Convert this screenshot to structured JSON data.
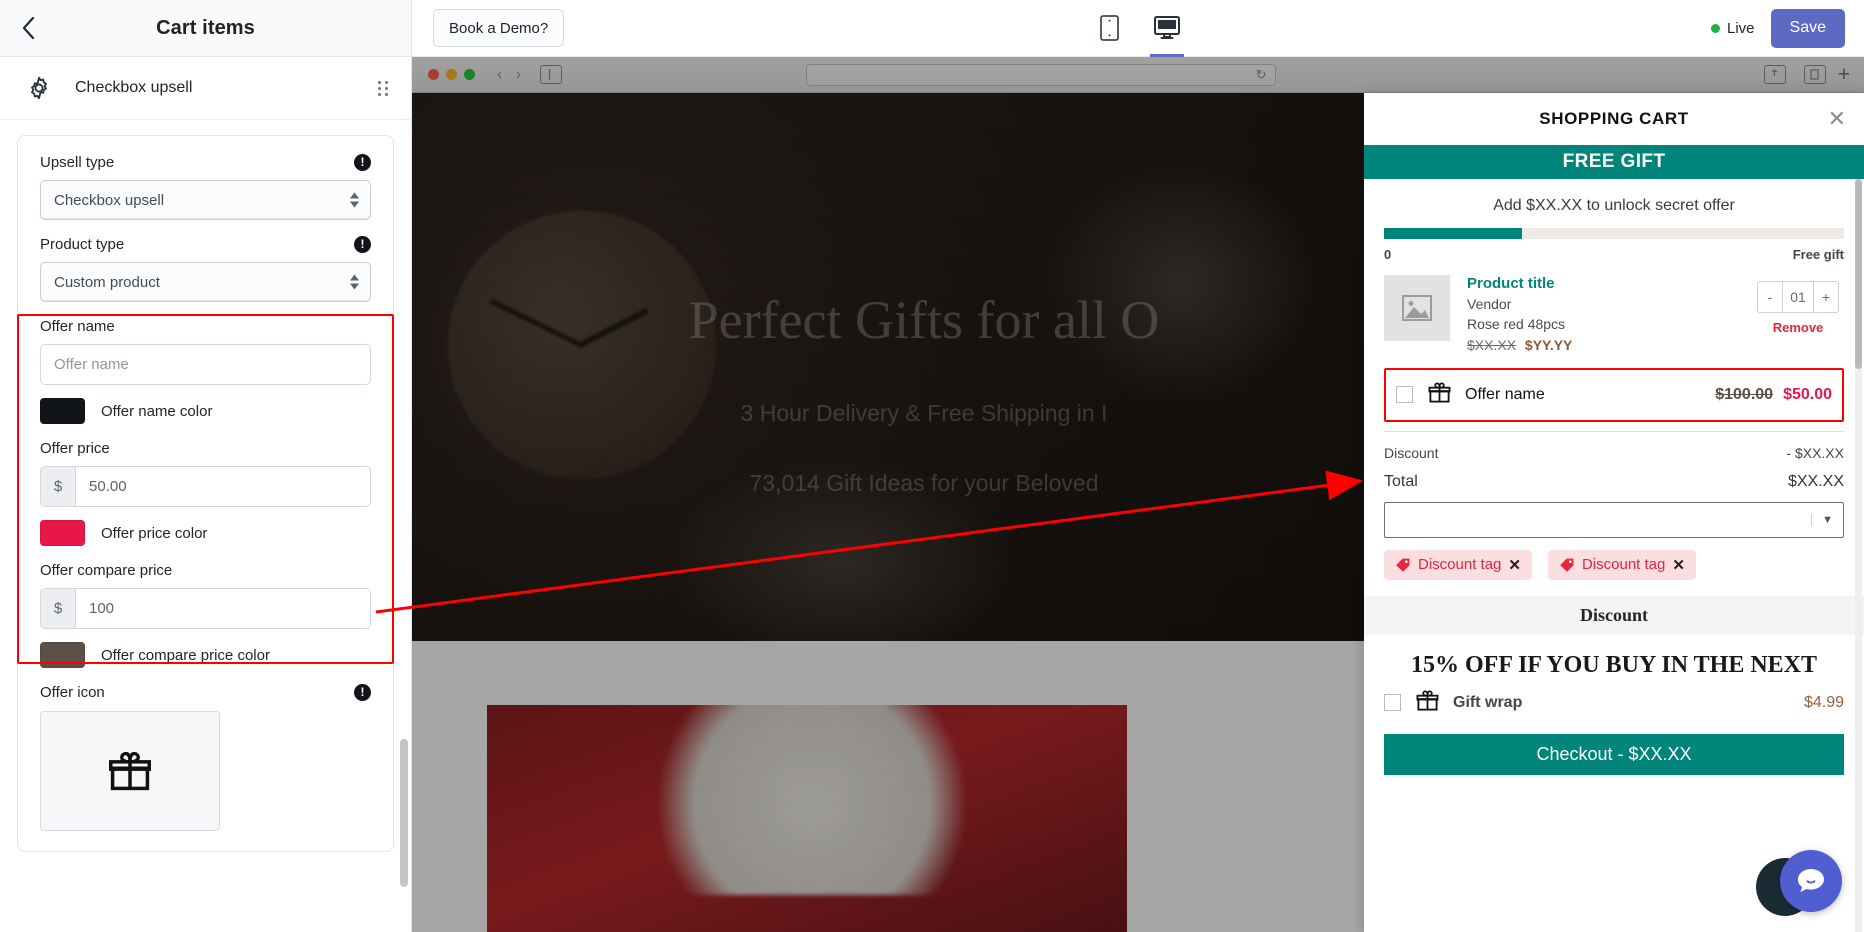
{
  "sidebar": {
    "back_icon": "chevron-left-icon",
    "title": "Cart items",
    "block": {
      "icon": "gear-icon",
      "label": "Checkbox upsell",
      "drag_icon": "drag-handle-icon"
    },
    "fields": {
      "upsell_type": {
        "label": "Upsell type",
        "value": "Checkbox upsell",
        "info": "!"
      },
      "product_type": {
        "label": "Product type",
        "value": "Custom product",
        "info": "!"
      },
      "offer_name": {
        "label": "Offer name",
        "placeholder": "Offer name",
        "value": ""
      },
      "offer_name_color": {
        "label": "Offer name color",
        "color": "#111418"
      },
      "offer_price": {
        "label": "Offer price",
        "prefix": "$",
        "value": "50.00"
      },
      "offer_price_color": {
        "label": "Offer price color",
        "color": "#e8174a"
      },
      "offer_compare_price": {
        "label": "Offer compare price",
        "prefix": "$",
        "value": "100"
      },
      "offer_compare_price_color": {
        "label": "Offer compare price color",
        "color": "#5c4f48"
      },
      "offer_icon": {
        "label": "Offer icon",
        "info": "!",
        "icon": "gift-icon"
      }
    }
  },
  "topbar": {
    "demo_label": "Book a Demo?",
    "devices": [
      {
        "name": "mobile-view",
        "icon": "mobile-icon",
        "active": false
      },
      {
        "name": "desktop-view",
        "icon": "desktop-icon",
        "active": true
      }
    ],
    "status_label": "Live",
    "status_color": "#22b04a",
    "save_label": "Save",
    "save_color": "#5c6ac4"
  },
  "browser": {
    "traffic_lights": [
      "#ff5f57",
      "#febc2e",
      "#28c840"
    ],
    "back_icon": "chevron-left-icon",
    "forward_icon": "chevron-right-icon",
    "sidebar_icon": "sidebar-toggle-icon",
    "address_value": "",
    "reload_icon": "reload-icon",
    "share_icon": "share-icon",
    "tabs_icon": "tabs-icon",
    "new_tab_label": "+"
  },
  "site": {
    "hero_title": "Perfect Gifts for all O",
    "hero_sub": "3 Hour Delivery & Free Shipping in I",
    "hero_sub2": "73,014 Gift Ideas for your Beloved"
  },
  "cart": {
    "title": "SHOPPING CART",
    "close_icon": "close-icon",
    "free_gift_banner": "FREE GIFT",
    "banner_color": "#00857a",
    "unlock_text": "Add $XX.XX to unlock secret offer",
    "progress_percent": 30,
    "progress_start_label": "0",
    "progress_end_label": "Free gift",
    "product": {
      "image_icon": "image-placeholder-icon",
      "title": "Product title",
      "vendor": "Vendor",
      "variant": "Rose red 48pcs",
      "compare_price": "$XX.XX",
      "price": "$YY.YY",
      "qty_minus": "-",
      "qty_value": "01",
      "qty_plus": "+",
      "remove_label": "Remove"
    },
    "upsell": {
      "icon": "gift-icon",
      "name": "Offer name",
      "compare_price": "$100.00",
      "price": "$50.00"
    },
    "discount_row": {
      "label": "Discount",
      "value": "- $XX.XX"
    },
    "total_row": {
      "label": "Total",
      "value": "$XX.XX"
    },
    "discount_select_value": "",
    "discount_tags": [
      {
        "icon": "tag-icon",
        "label": "Discount tag",
        "remove": "✕"
      },
      {
        "icon": "tag-icon",
        "label": "Discount tag",
        "remove": "✕"
      }
    ],
    "discount_header": "Discount",
    "promo_text": "15% OFF IF YOU BUY IN THE NEXT",
    "gift_wrap": {
      "icon": "gift-icon",
      "label": "Gift wrap",
      "price": "$4.99"
    },
    "checkout_label": "Checkout - $XX.XX"
  },
  "annotation": {
    "highlight_color": "#ff0000"
  }
}
